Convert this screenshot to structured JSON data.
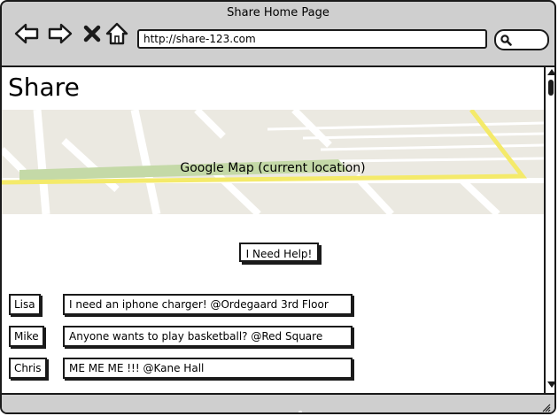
{
  "window": {
    "title": "Share Home Page"
  },
  "toolbar": {
    "address": "http://share-123.com"
  },
  "page": {
    "title": "Share"
  },
  "map": {
    "label": "Google Map (current location)"
  },
  "help": {
    "label": "I Need Help!"
  },
  "feed": [
    {
      "name": "Lisa",
      "message": "I need an iphone charger! @Ordegaard 3rd Floor"
    },
    {
      "name": "Mike",
      "message": "Anyone wants to play basketball? @Red Square"
    },
    {
      "name": "Chris",
      "message": "ME ME ME !!! @Kane Hall"
    }
  ],
  "colors": {
    "map_bg": "#ebe9e1",
    "map_road_highlight": "#f4ea6a",
    "map_park": "#c4d9a7",
    "chrome": "#cfcfcf"
  }
}
